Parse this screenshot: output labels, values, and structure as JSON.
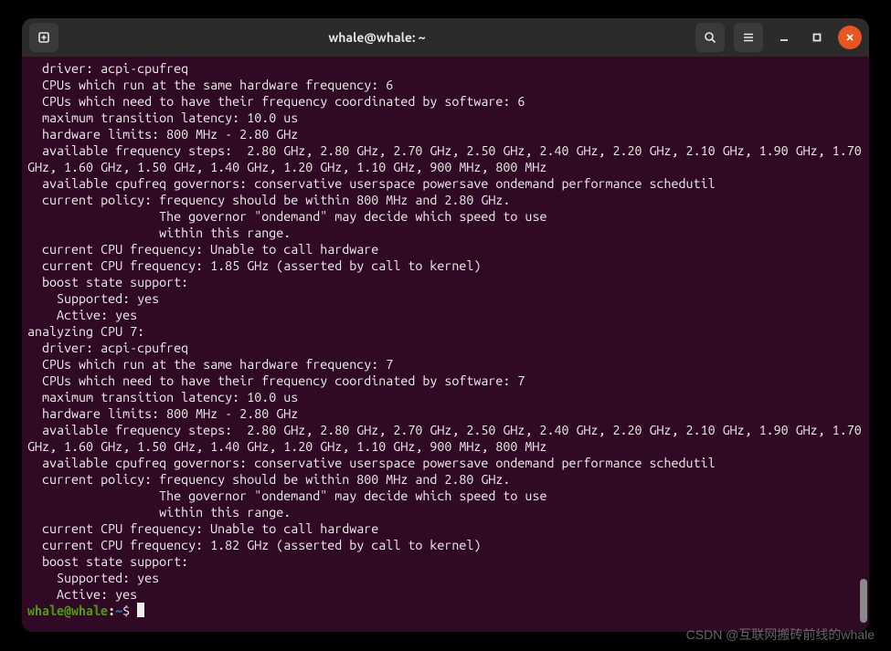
{
  "titlebar": {
    "title": "whale@whale: ~"
  },
  "terminal": {
    "lines": [
      "  driver: acpi-cpufreq",
      "  CPUs which run at the same hardware frequency: 6",
      "  CPUs which need to have their frequency coordinated by software: 6",
      "  maximum transition latency: 10.0 us",
      "  hardware limits: 800 MHz - 2.80 GHz",
      "  available frequency steps:  2.80 GHz, 2.80 GHz, 2.70 GHz, 2.50 GHz, 2.40 GHz, 2.20 GHz, 2.10 GHz, 1.90 GHz, 1.70 GHz, 1.60 GHz, 1.50 GHz, 1.40 GHz, 1.20 GHz, 1.10 GHz, 900 MHz, 800 MHz",
      "  available cpufreq governors: conservative userspace powersave ondemand performance schedutil",
      "  current policy: frequency should be within 800 MHz and 2.80 GHz.",
      "                  The governor \"ondemand\" may decide which speed to use",
      "                  within this range.",
      "  current CPU frequency: Unable to call hardware",
      "  current CPU frequency: 1.85 GHz (asserted by call to kernel)",
      "  boost state support:",
      "    Supported: yes",
      "    Active: yes",
      "analyzing CPU 7:",
      "  driver: acpi-cpufreq",
      "  CPUs which run at the same hardware frequency: 7",
      "  CPUs which need to have their frequency coordinated by software: 7",
      "  maximum transition latency: 10.0 us",
      "  hardware limits: 800 MHz - 2.80 GHz",
      "  available frequency steps:  2.80 GHz, 2.80 GHz, 2.70 GHz, 2.50 GHz, 2.40 GHz, 2.20 GHz, 2.10 GHz, 1.90 GHz, 1.70 GHz, 1.60 GHz, 1.50 GHz, 1.40 GHz, 1.20 GHz, 1.10 GHz, 900 MHz, 800 MHz",
      "  available cpufreq governors: conservative userspace powersave ondemand performance schedutil",
      "  current policy: frequency should be within 800 MHz and 2.80 GHz.",
      "                  The governor \"ondemand\" may decide which speed to use",
      "                  within this range.",
      "  current CPU frequency: Unable to call hardware",
      "  current CPU frequency: 1.82 GHz (asserted by call to kernel)",
      "  boost state support:",
      "    Supported: yes",
      "    Active: yes"
    ],
    "prompt": {
      "user_host": "whale@whale",
      "colon": ":",
      "path": "~",
      "dollar": "$ "
    }
  },
  "watermark": "CSDN @互联网搬砖前线的whale"
}
